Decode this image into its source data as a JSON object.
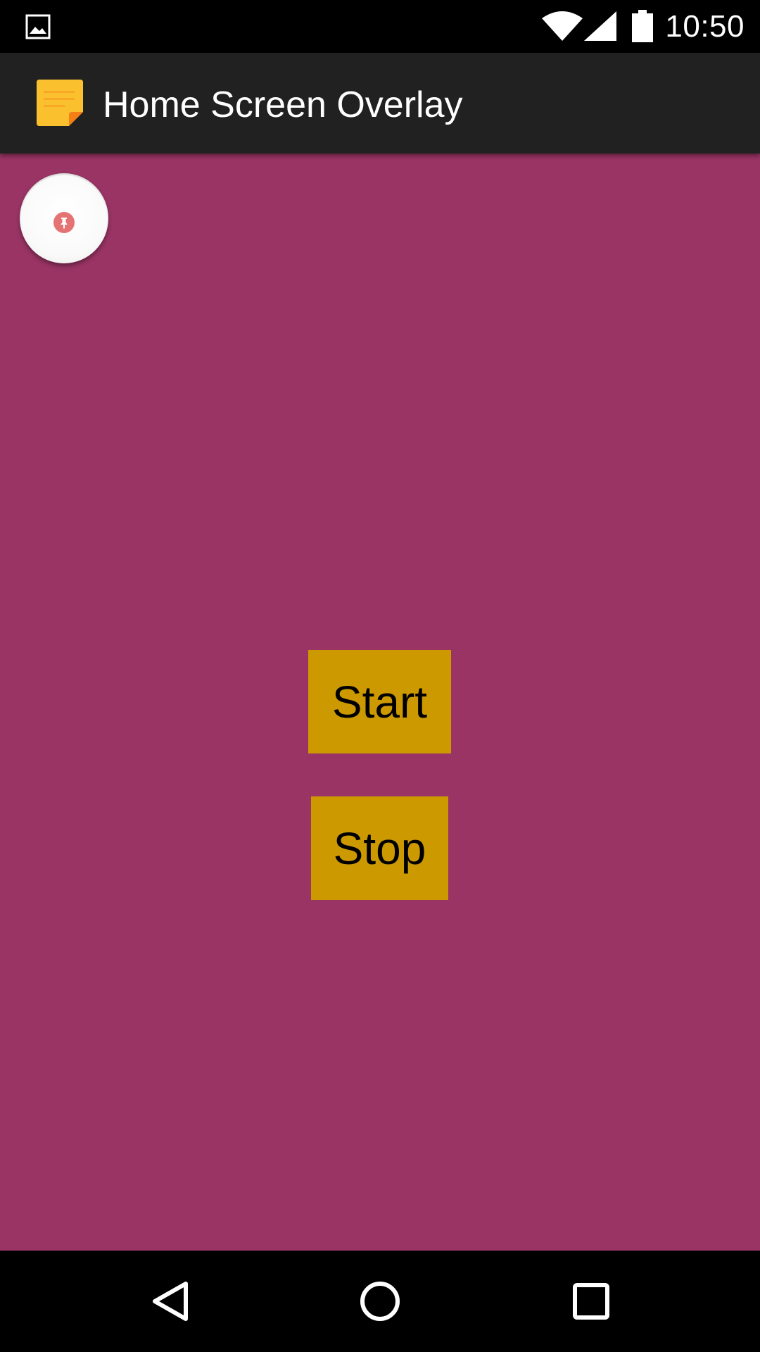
{
  "status_bar": {
    "time": "10:50",
    "icons": [
      "gallery-notification-icon",
      "wifi-icon",
      "cell-signal-icon",
      "battery-icon"
    ]
  },
  "app_bar": {
    "title": "Home Screen Overlay",
    "icon": "sticky-note-icon"
  },
  "overlay": {
    "icon": "pin-icon"
  },
  "buttons": {
    "start_label": "Start",
    "stop_label": "Stop"
  },
  "nav_bar": {
    "icons": [
      "back-icon",
      "home-icon",
      "recents-icon"
    ]
  },
  "colors": {
    "content_background": "#993464",
    "button_background": "#cc9900",
    "app_bar_background": "#212121",
    "pin_accent": "#e57373"
  }
}
